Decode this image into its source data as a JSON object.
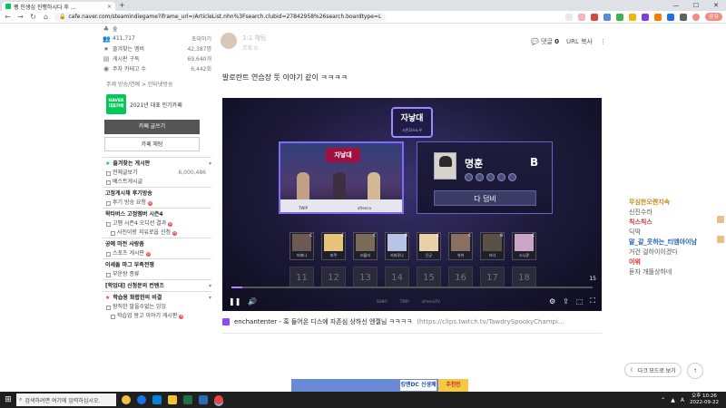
{
  "browser": {
    "tab_title": "펭 인생심 진행하시다 후 ...",
    "tab_close": "×",
    "new_tab": "+",
    "url": "cafe.naver.com/steamindiegame?iframe_url=/ArticleList.nhn%3Fsearch.clubid=27842958%26search.boardtype=L",
    "profile_label": "공유",
    "nav": {
      "back": "←",
      "forward": "→",
      "reload": "↻",
      "home": "⌂"
    },
    "window": {
      "minimize": "—",
      "maximize": "☐",
      "close": "✕"
    }
  },
  "sidebar": {
    "member_level": "숲",
    "member_count": "411,717",
    "member_count_label": "초대하기",
    "stats": [
      {
        "label": "즐겨찾는 멤버",
        "value": "42,387명"
      },
      {
        "label": "게시판 구독",
        "value": "69,640개"
      },
      {
        "label": "주차 카테고 수",
        "value": "6,442회"
      }
    ],
    "breadcrumb": "주제  방송/연예 > 인터넷방송",
    "badge_text": "NAVER 대표카페",
    "badge_caption": "2021년 대표 인기카페",
    "write_button": "카페 글쓰기",
    "chat_button": "카페 채팅",
    "menu": [
      {
        "type": "head",
        "label": "즐겨찾는 게시판",
        "star": true
      },
      {
        "type": "item",
        "label": "전체글보기",
        "count": "6,000,486",
        "box": true
      },
      {
        "type": "item",
        "label": "베스트게시글",
        "box": true
      },
      {
        "type": "head",
        "label": "고정게시채 후기방송"
      },
      {
        "type": "item",
        "label": "후기 방송 요청",
        "new": true,
        "box": true
      },
      {
        "type": "head",
        "label": "왁타버스 고정멤버 시즌4"
      },
      {
        "type": "item",
        "label": "고멤 시즌4 오디션 결과",
        "new": true,
        "box": true
      },
      {
        "type": "item",
        "label": "사진이랑 지유로웁 신청",
        "new": true,
        "box": true,
        "sub": true
      },
      {
        "type": "head",
        "label": "공예 미전 사랑좀"
      },
      {
        "type": "item",
        "label": "스포츠 게시판",
        "new": true,
        "box": true
      },
      {
        "type": "head",
        "label": "이세돌 마그 부족전쟁"
      },
      {
        "type": "item",
        "label": "부운왕 종류",
        "box": true
      },
      {
        "type": "head",
        "label": "[학업대] 신청문의 컨텐츠",
        "chev": true
      },
      {
        "type": "head",
        "label": "학습용 화합한의 비결",
        "star": true
      },
      {
        "type": "item",
        "label": "왕직한 말을수없는 잉잉",
        "box": true
      },
      {
        "type": "item",
        "label": "학습업 왕고 이야기 게시판",
        "new": true,
        "box": true,
        "sub": true
      }
    ]
  },
  "article": {
    "author_name": "1:1 채팅",
    "author_meta": "조회 0",
    "comments_label": "댓글",
    "comments_count": "0",
    "url_copy": "URL 복사",
    "more_icon": "⋮",
    "body_text": "발로란트 연습장 뜻 이야기 같이 ㅋㅋㅋㅋ",
    "clip_title": "enchantenter - 혹 들어온 디스에 자존심 상하신 엔젤님 ㅋㅋㅋㅋ",
    "clip_url": "(https://clips.twitch.tv/TawdrySpookyChampi..."
  },
  "video": {
    "logo_title": "자낳대",
    "logo_sub": "시즌2/스노우",
    "studio_sign": "자낳대",
    "desk_left": "TWIP",
    "desk_right": "afreeca",
    "player_name": "명훈",
    "player_tier": "B",
    "pick_button": "다 덤비",
    "roster": [
      {
        "name": "미래나",
        "tier": "C"
      },
      {
        "name": "마쿠",
        "tier": "C"
      },
      {
        "name": "러블리",
        "tier": "C"
      },
      {
        "name": "카와루나",
        "tier": "B"
      },
      {
        "name": "단군",
        "tier": "C"
      },
      {
        "name": "쉬쉬",
        "tier": "C"
      },
      {
        "name": "러너",
        "tier": "B"
      },
      {
        "name": "스니큐",
        "tier": "C"
      }
    ],
    "numbers": [
      "11",
      "12",
      "13",
      "14",
      "15",
      "16",
      "17",
      "18"
    ],
    "countdown": "15",
    "progress": 0.03,
    "controls": {
      "pause": "❚❚",
      "volume": "🔊",
      "settings": "⚙",
      "share": "⇪",
      "theater": "⬚",
      "fullscreen": "⛶"
    },
    "sponsors": [
      "SUNO",
      "TWIP",
      "afreecaTV"
    ]
  },
  "banner": {
    "middle": "킹맨DC 신생쾌",
    "right": "추천인"
  },
  "chat": [
    {
      "name": "무심한오렌지속",
      "msg": "신진수라",
      "color": "#c58a1d"
    },
    {
      "name": "칙스칙스",
      "msg": "딕딱",
      "color": "#c0392b"
    },
    {
      "name": "말_갈_웃하는_티엠아이남",
      "msg": "거건 걸하이이겠다",
      "color": "#1f5fb0"
    },
    {
      "name": "이위",
      "msg": "듣자 개똘상하네",
      "color": "#e02020"
    }
  ],
  "dark_mode_button": "다크 모드로 보기",
  "scroll_top_icon": "↑",
  "taskbar": {
    "search_placeholder": "검색하려면 여기에 입력하십시오.",
    "time": "오후 10:26",
    "date": "2022-09-22",
    "lang": "A"
  },
  "colors": {
    "naver_green": "#03c75a",
    "twitch_purple": "#9146ff"
  }
}
